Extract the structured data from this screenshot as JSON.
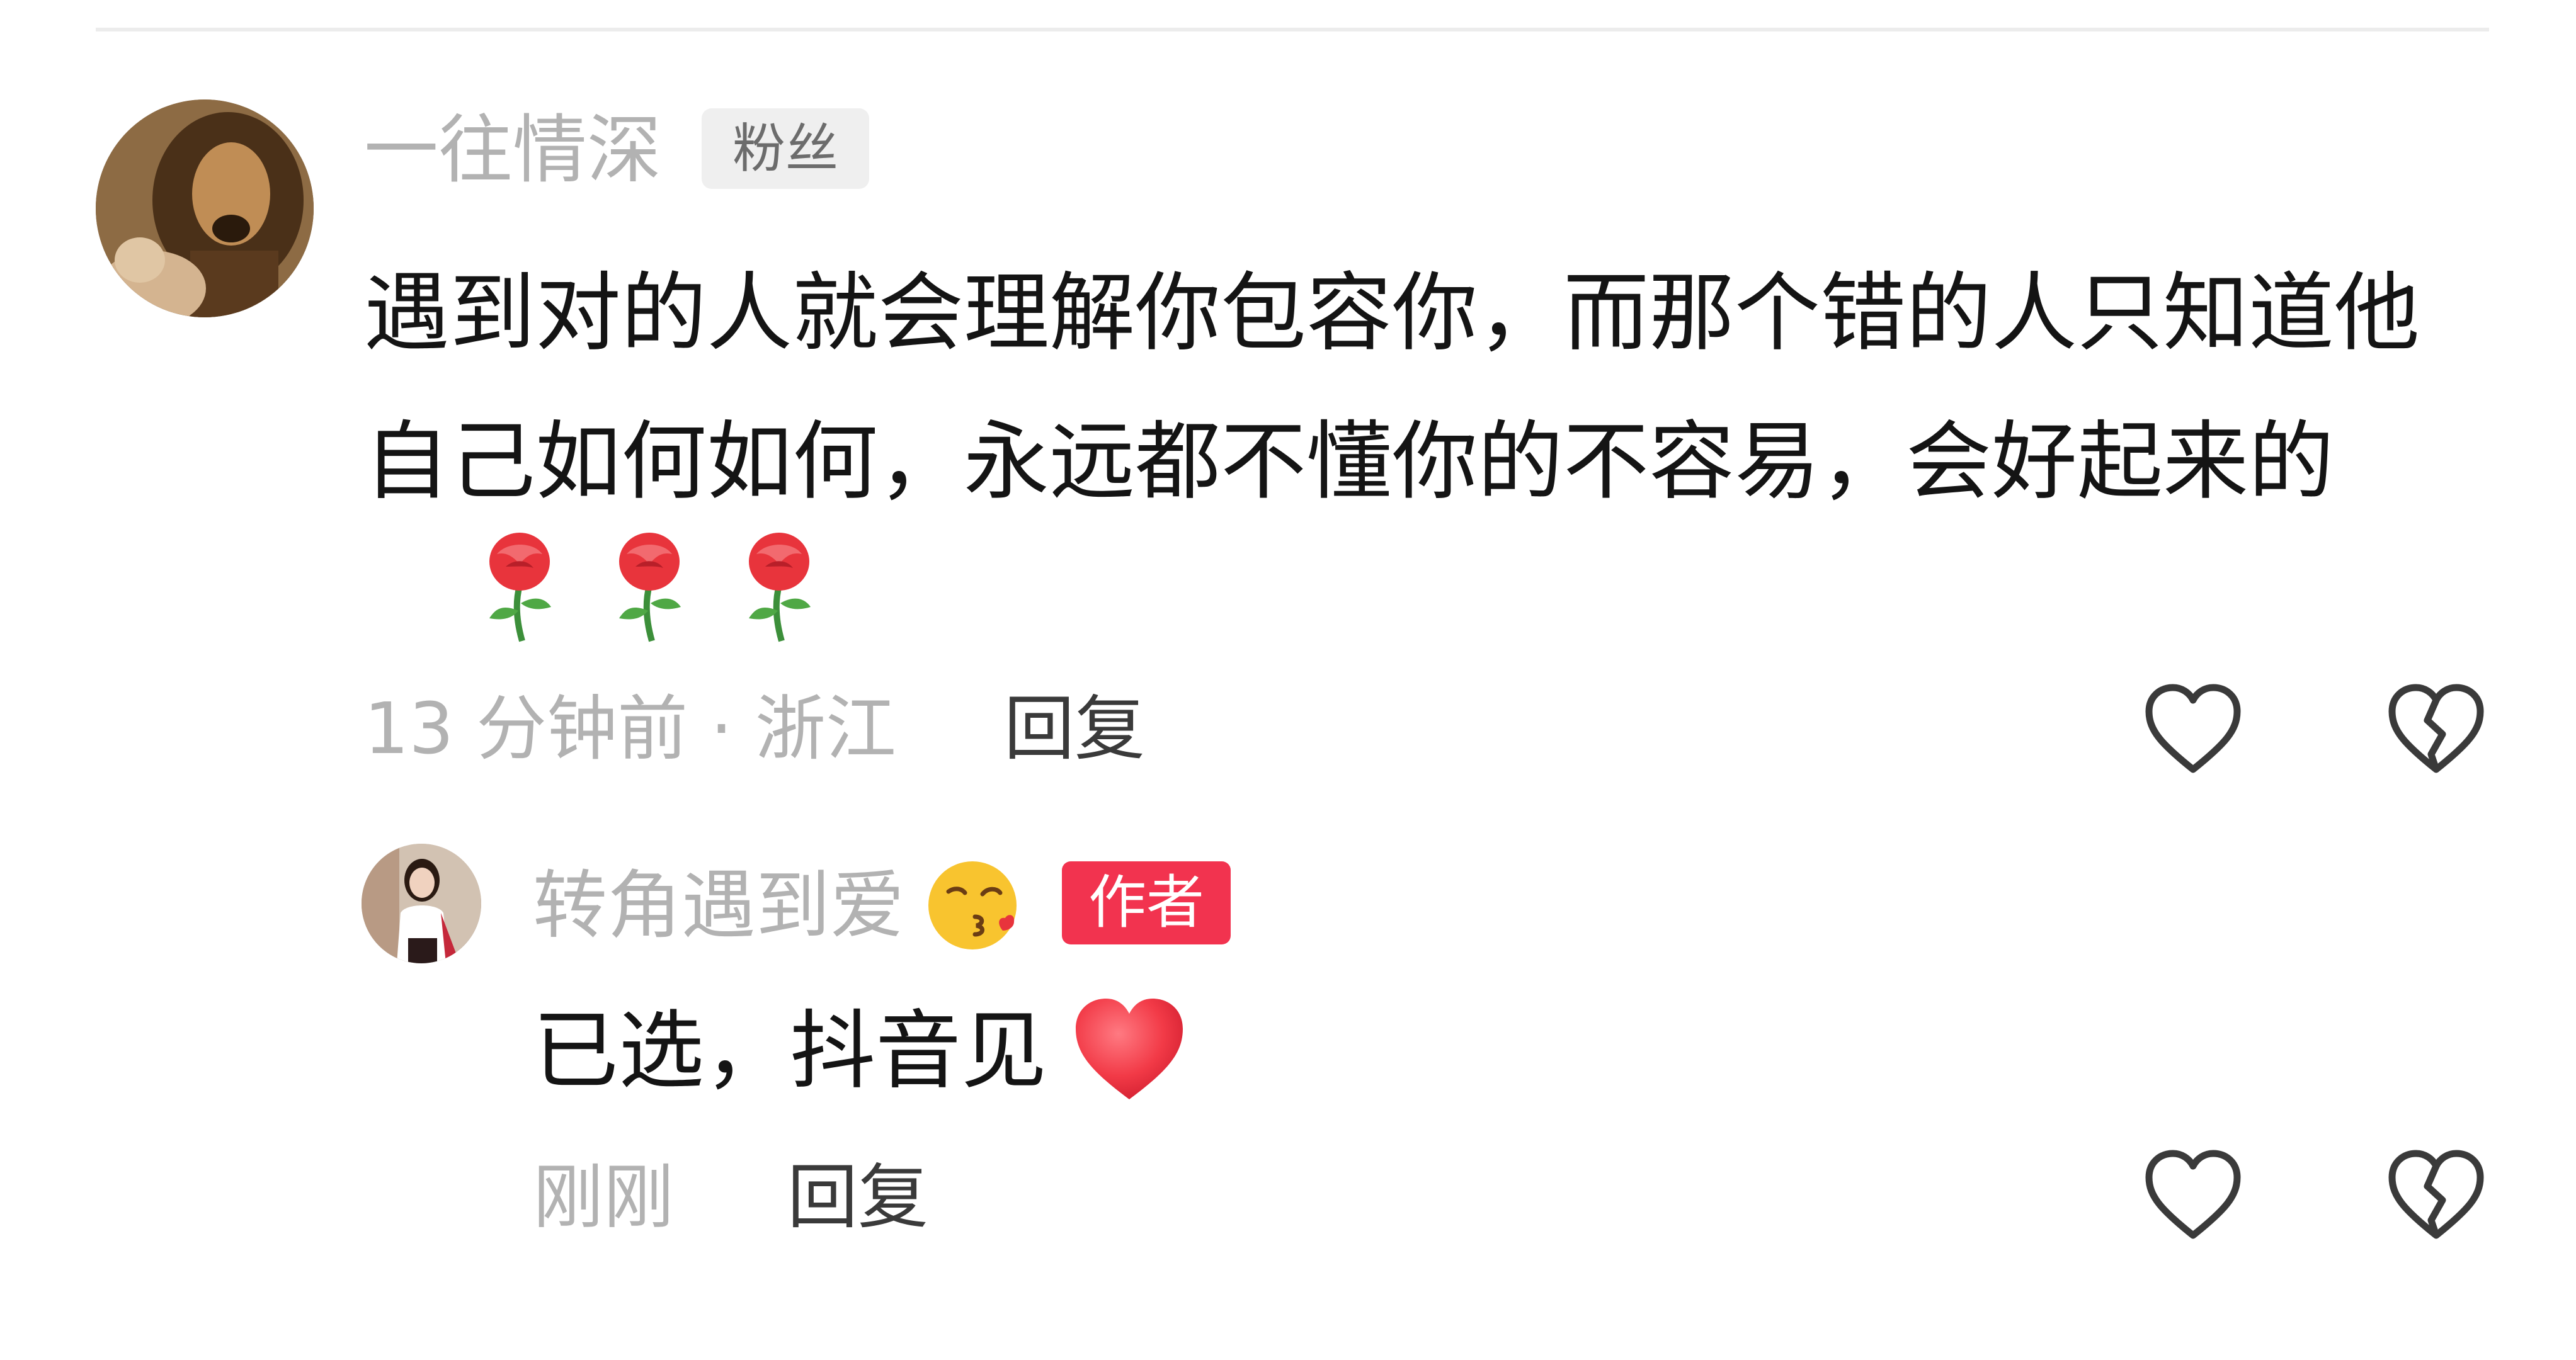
{
  "main_comment": {
    "username": "一往情深",
    "badge": "粉丝",
    "text": "遇到对的人就会理解你包容你，而那个错的人只知道他自己如何如何，永远都不懂你的不容易，会好起来的",
    "emoji": [
      "rose-emoji",
      "rose-emoji",
      "rose-emoji"
    ],
    "meta": "13 分钟前 · 浙江",
    "reply_label": "回复",
    "like_icon": "heart-outline-icon",
    "dislike_icon": "broken-heart-outline-icon"
  },
  "reply_comment": {
    "username": "转角遇到爱",
    "username_emoji": "kissing-heart-emoji",
    "badge": "作者",
    "badge_color": "#f2334f",
    "text": "已选，抖音见",
    "text_emoji": "red-heart-emoji",
    "meta": "刚刚",
    "reply_label": "回复",
    "like_icon": "heart-outline-icon",
    "dislike_icon": "broken-heart-outline-icon"
  },
  "colors": {
    "username": "#b2b2b2",
    "body_text": "#141414",
    "reply_link": "#3a3a3a",
    "fan_badge_bg": "#efefef",
    "icon_stroke": "#3a3a3a"
  }
}
